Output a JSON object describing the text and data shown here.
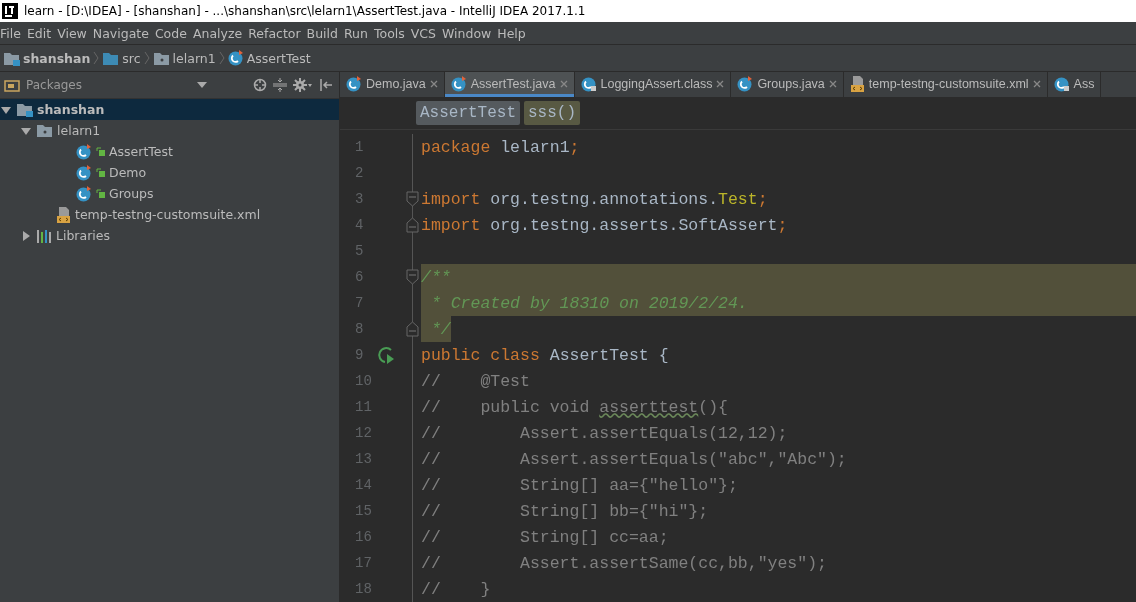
{
  "window": {
    "title": "learn - [D:\\IDEA] - [shanshan] - ...\\shanshan\\src\\lelarn1\\AssertTest.java - IntelliJ IDEA 2017.1.1"
  },
  "menu": [
    "File",
    "Edit",
    "View",
    "Navigate",
    "Code",
    "Analyze",
    "Refactor",
    "Build",
    "Run",
    "Tools",
    "VCS",
    "Window",
    "Help"
  ],
  "breadcrumb": [
    {
      "label": "shanshan",
      "kind": "module"
    },
    {
      "label": "src",
      "kind": "folder"
    },
    {
      "label": "lelarn1",
      "kind": "package"
    },
    {
      "label": "AssertTest",
      "kind": "class"
    }
  ],
  "project_panel": {
    "title": "Packages",
    "tree": [
      {
        "label": "shanshan",
        "kind": "module",
        "expanded": true,
        "selected": true,
        "children": [
          {
            "label": "lelarn1",
            "kind": "package",
            "expanded": true,
            "selected": false,
            "children": [
              {
                "label": "AssertTest",
                "kind": "class",
                "selected": false
              },
              {
                "label": "Demo",
                "kind": "class",
                "selected": false
              },
              {
                "label": "Groups",
                "kind": "class",
                "selected": false
              },
              {
                "label": "temp-testng-customsuite.xml",
                "kind": "xml",
                "selected": false
              }
            ]
          },
          {
            "label": "Libraries",
            "kind": "libraries",
            "expanded": false,
            "selected": false
          }
        ]
      }
    ]
  },
  "tabs": [
    {
      "label": "Demo.java",
      "kind": "class",
      "selected": false
    },
    {
      "label": "AssertTest.java",
      "kind": "class",
      "selected": true
    },
    {
      "label": "LoggingAssert.class",
      "kind": "locked-class",
      "selected": false
    },
    {
      "label": "Groups.java",
      "kind": "class",
      "selected": false
    },
    {
      "label": "temp-testng-customsuite.xml",
      "kind": "xml",
      "selected": false
    },
    {
      "label": "Ass",
      "kind": "locked-class",
      "selected": false
    }
  ],
  "editor_breadcrumb": [
    {
      "label": "AssertTest",
      "kind": "class"
    },
    {
      "label": "sss()",
      "kind": "method"
    }
  ],
  "code": [
    {
      "number": "1",
      "selected": false,
      "fold_start": false,
      "fold_end": false,
      "run": false,
      "tokens": [
        {
          "text": "package ",
          "kind": "keyword"
        },
        {
          "text": "lelarn1",
          "kind": "plain"
        },
        {
          "text": ";",
          "kind": "keyword"
        }
      ]
    },
    {
      "number": "2",
      "selected": false,
      "fold_start": false,
      "fold_end": false,
      "run": false
    },
    {
      "number": "3",
      "selected": false,
      "fold_start": true,
      "fold_end": false,
      "run": false,
      "tokens": [
        {
          "text": "import ",
          "kind": "keyword"
        },
        {
          "text": "org.testng.annotations.",
          "kind": "plain"
        },
        {
          "text": "Test",
          "kind": "annotation"
        },
        {
          "text": ";",
          "kind": "keyword"
        }
      ]
    },
    {
      "number": "4",
      "selected": false,
      "fold_start": false,
      "fold_end": true,
      "run": false,
      "tokens": [
        {
          "text": "import ",
          "kind": "keyword"
        },
        {
          "text": "org.testng.asserts.SoftAssert",
          "kind": "plain"
        },
        {
          "text": ";",
          "kind": "keyword"
        }
      ]
    },
    {
      "number": "5",
      "selected": false,
      "fold_start": false,
      "fold_end": false,
      "run": false
    },
    {
      "number": "6",
      "selected": true,
      "fold_start": true,
      "fold_end": false,
      "run": false,
      "tokens": [
        {
          "text": "/**",
          "kind": "doc"
        }
      ]
    },
    {
      "number": "7",
      "selected": true,
      "fold_start": false,
      "fold_end": false,
      "run": false,
      "tokens": [
        {
          "text": " * Created by 18310 on 2019/2/24.",
          "kind": "doc"
        }
      ]
    },
    {
      "number": "8",
      "selected": true,
      "fold_start": false,
      "fold_end": true,
      "run": false,
      "tokens": [
        {
          "text": " */",
          "kind": "doc"
        }
      ]
    },
    {
      "number": "9",
      "selected": false,
      "fold_start": false,
      "fold_end": false,
      "run": true,
      "tokens": [
        {
          "text": "public class ",
          "kind": "keyword"
        },
        {
          "text": "AssertTest ",
          "kind": "plain"
        },
        {
          "text": "{",
          "kind": "plain"
        }
      ]
    },
    {
      "number": "10",
      "selected": false,
      "fold_start": false,
      "fold_end": false,
      "run": false,
      "tokens": [
        {
          "text": "//    @Test",
          "kind": "commented"
        }
      ]
    },
    {
      "number": "11",
      "selected": false,
      "fold_start": false,
      "fold_end": false,
      "run": false,
      "tokens": [
        {
          "text": "//    public void ",
          "kind": "commented"
        },
        {
          "text": "asserttest",
          "kind": "commented-warning"
        },
        {
          "text": "(){",
          "kind": "commented"
        }
      ]
    },
    {
      "number": "12",
      "selected": false,
      "fold_start": false,
      "fold_end": false,
      "run": false,
      "tokens": [
        {
          "text": "//        Assert.assertEquals(12,12);",
          "kind": "commented"
        }
      ]
    },
    {
      "number": "13",
      "selected": false,
      "fold_start": false,
      "fold_end": false,
      "run": false,
      "tokens": [
        {
          "text": "//        Assert.assertEquals(\"abc\",\"Abc\");",
          "kind": "commented"
        }
      ]
    },
    {
      "number": "14",
      "selected": false,
      "fold_start": false,
      "fold_end": false,
      "run": false,
      "tokens": [
        {
          "text": "//        String[] aa={\"hello\"};",
          "kind": "commented"
        }
      ]
    },
    {
      "number": "15",
      "selected": false,
      "fold_start": false,
      "fold_end": false,
      "run": false,
      "tokens": [
        {
          "text": "//        String[] bb={\"hi\"};",
          "kind": "commented"
        }
      ]
    },
    {
      "number": "16",
      "selected": false,
      "fold_start": false,
      "fold_end": false,
      "run": false,
      "tokens": [
        {
          "text": "//        String[] cc=aa;",
          "kind": "commented"
        }
      ]
    },
    {
      "number": "17",
      "selected": false,
      "fold_start": false,
      "fold_end": false,
      "run": false,
      "tokens": [
        {
          "text": "//        Assert.assertSame(cc,bb,\"yes\");",
          "kind": "commented"
        }
      ]
    },
    {
      "number": "18",
      "selected": false,
      "fold_start": false,
      "fold_end": false,
      "run": false,
      "tokens": [
        {
          "text": "//    }",
          "kind": "commented"
        }
      ]
    }
  ]
}
